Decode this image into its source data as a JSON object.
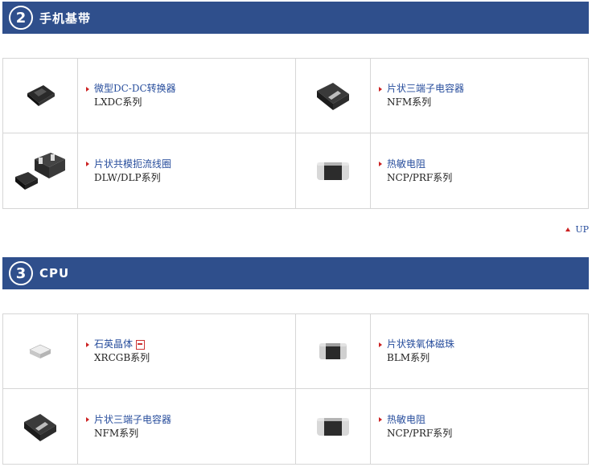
{
  "sections": [
    {
      "number": "2",
      "title": "手机基带",
      "products": [
        {
          "name": "微型DC-DC转换器",
          "series": "LXDC系列",
          "icon": "dcdc-module-icon"
        },
        {
          "name": "片状三端子电容器",
          "series": "NFM系列",
          "icon": "chip-capacitor-icon"
        },
        {
          "name": "片状共模扼流线圈",
          "series": "DLW/DLP系列",
          "icon": "common-mode-choke-icon"
        },
        {
          "name": "热敏电阻",
          "series": "NCP/PRF系列",
          "icon": "thermistor-icon"
        }
      ]
    },
    {
      "number": "3",
      "title": "CPU",
      "products": [
        {
          "name": "石英晶体",
          "series": "XRCGB系列",
          "icon": "crystal-icon"
        },
        {
          "name": "片状铁氧体磁珠",
          "series": "BLM系列",
          "icon": "ferrite-bead-icon"
        },
        {
          "name": "片状三端子电容器",
          "series": "NFM系列",
          "icon": "chip-capacitor-icon"
        },
        {
          "name": "热敏电阻",
          "series": "NCP/PRF系列",
          "icon": "thermistor-icon"
        }
      ]
    }
  ],
  "up_link": "UP",
  "colors": {
    "header": "#2f4f8c",
    "link": "#274d9c",
    "arrow": "#cc2222"
  }
}
